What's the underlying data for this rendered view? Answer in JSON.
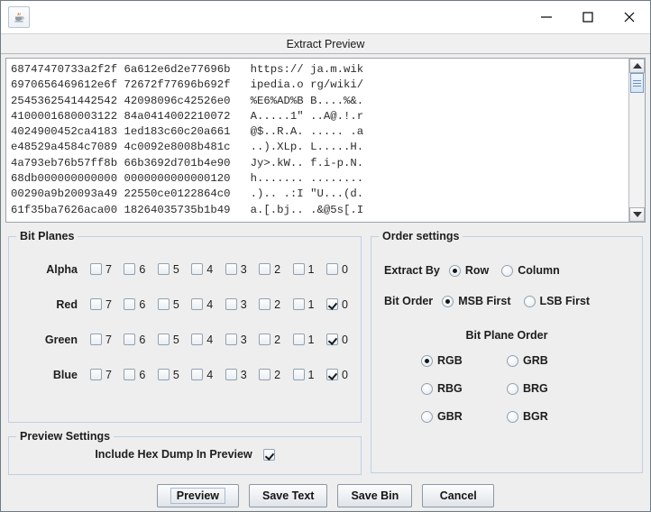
{
  "window": {
    "app_icon": "java-coffee-cup-icon",
    "minimize_label": "minimize-icon",
    "maximize_label": "maximize-icon",
    "close_label": "close-icon"
  },
  "header": {
    "title": "Extract Preview"
  },
  "hexdump": {
    "lines": [
      "68747470733a2f2f 6a612e6d2e77696b   https:// ja.m.wik",
      "6970656469612e6f 72672f77696b692f   ipedia.o rg/wiki/",
      "2545362541442542 42098096c42526e0   %E6%AD%B B....%&.",
      "4100001680003122 84a0414002210072   A.....1\" ..A@.!.r",
      "4024900452ca4183 1ed183c60c20a661   @$..R.A. ..... .a",
      "e48529a4584c7089 4c0092e8008b481c   ..).XLp. L.....H.",
      "4a793eb76b57ff8b 66b3692d701b4e90   Jy>.kW.. f.i-p.N.",
      "68db000000000000 0000000000000120   h....... ........",
      "00290a9b20093a49 22550ce0122864c0   .).. .:I \"U...(d.",
      "61f35ba7626aca00 18264035735b1b49   a.[.bj.. .&@5s[.I"
    ],
    "scrollbar": {
      "up_arrow": "scroll-up-icon",
      "down_arrow": "scroll-down-icon"
    }
  },
  "bit_planes": {
    "title": "Bit Planes",
    "bits": [
      "7",
      "6",
      "5",
      "4",
      "3",
      "2",
      "1",
      "0"
    ],
    "rows": [
      {
        "label": "Alpha",
        "checked": [
          false,
          false,
          false,
          false,
          false,
          false,
          false,
          false
        ]
      },
      {
        "label": "Red",
        "checked": [
          false,
          false,
          false,
          false,
          false,
          false,
          false,
          true
        ]
      },
      {
        "label": "Green",
        "checked": [
          false,
          false,
          false,
          false,
          false,
          false,
          false,
          true
        ]
      },
      {
        "label": "Blue",
        "checked": [
          false,
          false,
          false,
          false,
          false,
          false,
          false,
          true
        ]
      }
    ]
  },
  "preview_settings": {
    "title": "Preview Settings",
    "include_hex_dump_label": "Include Hex Dump In Preview",
    "include_hex_dump_checked": true
  },
  "order_settings": {
    "title": "Order settings",
    "extract_by": {
      "label": "Extract By",
      "options": [
        "Row",
        "Column"
      ],
      "selected": "Row"
    },
    "bit_order": {
      "label": "Bit Order",
      "options": [
        "MSB First",
        "LSB First"
      ],
      "selected": "MSB First"
    },
    "bit_plane_order": {
      "label": "Bit Plane Order",
      "options": [
        "RGB",
        "GRB",
        "RBG",
        "BRG",
        "GBR",
        "BGR"
      ],
      "selected": "RGB"
    }
  },
  "footer": {
    "buttons": [
      "Preview",
      "Save Text",
      "Save Bin",
      "Cancel"
    ],
    "focused": "Preview"
  },
  "colors": {
    "window_bg": "#eeeeee",
    "panel_border": "#bed0e4",
    "text": "#1d1d1d",
    "textarea_bg": "#ffffff"
  }
}
